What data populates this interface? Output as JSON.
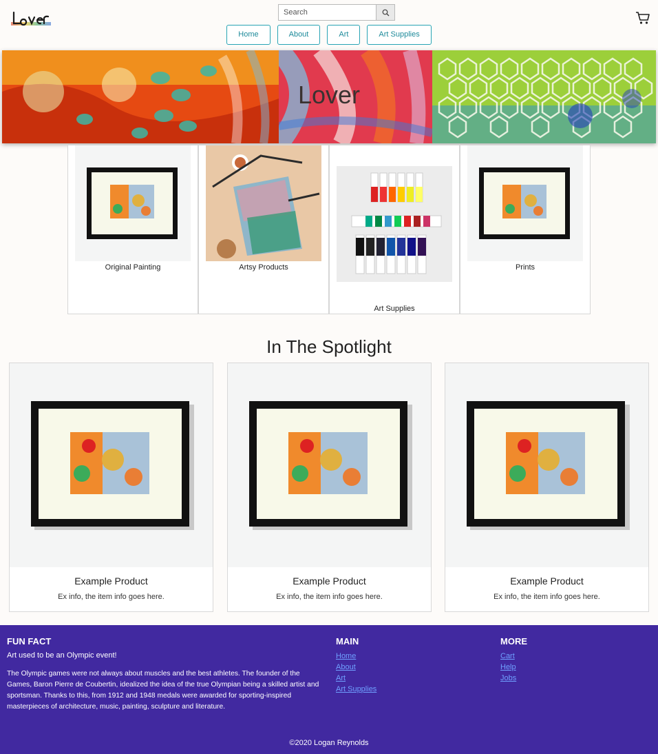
{
  "header": {
    "logo_text": "Lover",
    "search_placeholder": "Search"
  },
  "nav": [
    {
      "label": "Home"
    },
    {
      "label": "About"
    },
    {
      "label": "Art"
    },
    {
      "label": "Art Supplies"
    }
  ],
  "hero": {
    "title": "Lover"
  },
  "categories": [
    {
      "label": "Original Painting"
    },
    {
      "label": "Artsy Products"
    },
    {
      "label": "Art Supplies"
    },
    {
      "label": "Prints"
    }
  ],
  "spotlight": {
    "title": "In The Spotlight",
    "items": [
      {
        "title": "Example Product",
        "info": "Ex info, the item info goes here."
      },
      {
        "title": "Example Product",
        "info": "Ex info, the item info goes here."
      },
      {
        "title": "Example Product",
        "info": "Ex info, the item info goes here."
      }
    ]
  },
  "footer": {
    "fun_fact_title": "FUN FACT",
    "fun_fact_sub": "Art used to be an Olympic event!",
    "fun_fact_text": "The Olympic games were not always about muscles and the best athletes. The founder of the Games, Baron Pierre de Coubertin, idealized the idea of the true Olympian being a skilled artist and sportsman. Thanks to this, from 1912 and 1948 medals were awarded for sporting-inspired masterpieces of architecture, music, painting, sculpture and literature.",
    "main_title": "MAIN",
    "main_links": [
      "Home",
      "About",
      "Art",
      "Art Supplies"
    ],
    "more_title": "MORE",
    "more_links": [
      "Cart",
      "Help",
      "Jobs"
    ],
    "copyright": "©2020 Logan Reynolds"
  },
  "colors": {
    "footer_bg": "#4129a0",
    "nav_accent": "#27a3b4",
    "link": "#6fa0ff"
  }
}
